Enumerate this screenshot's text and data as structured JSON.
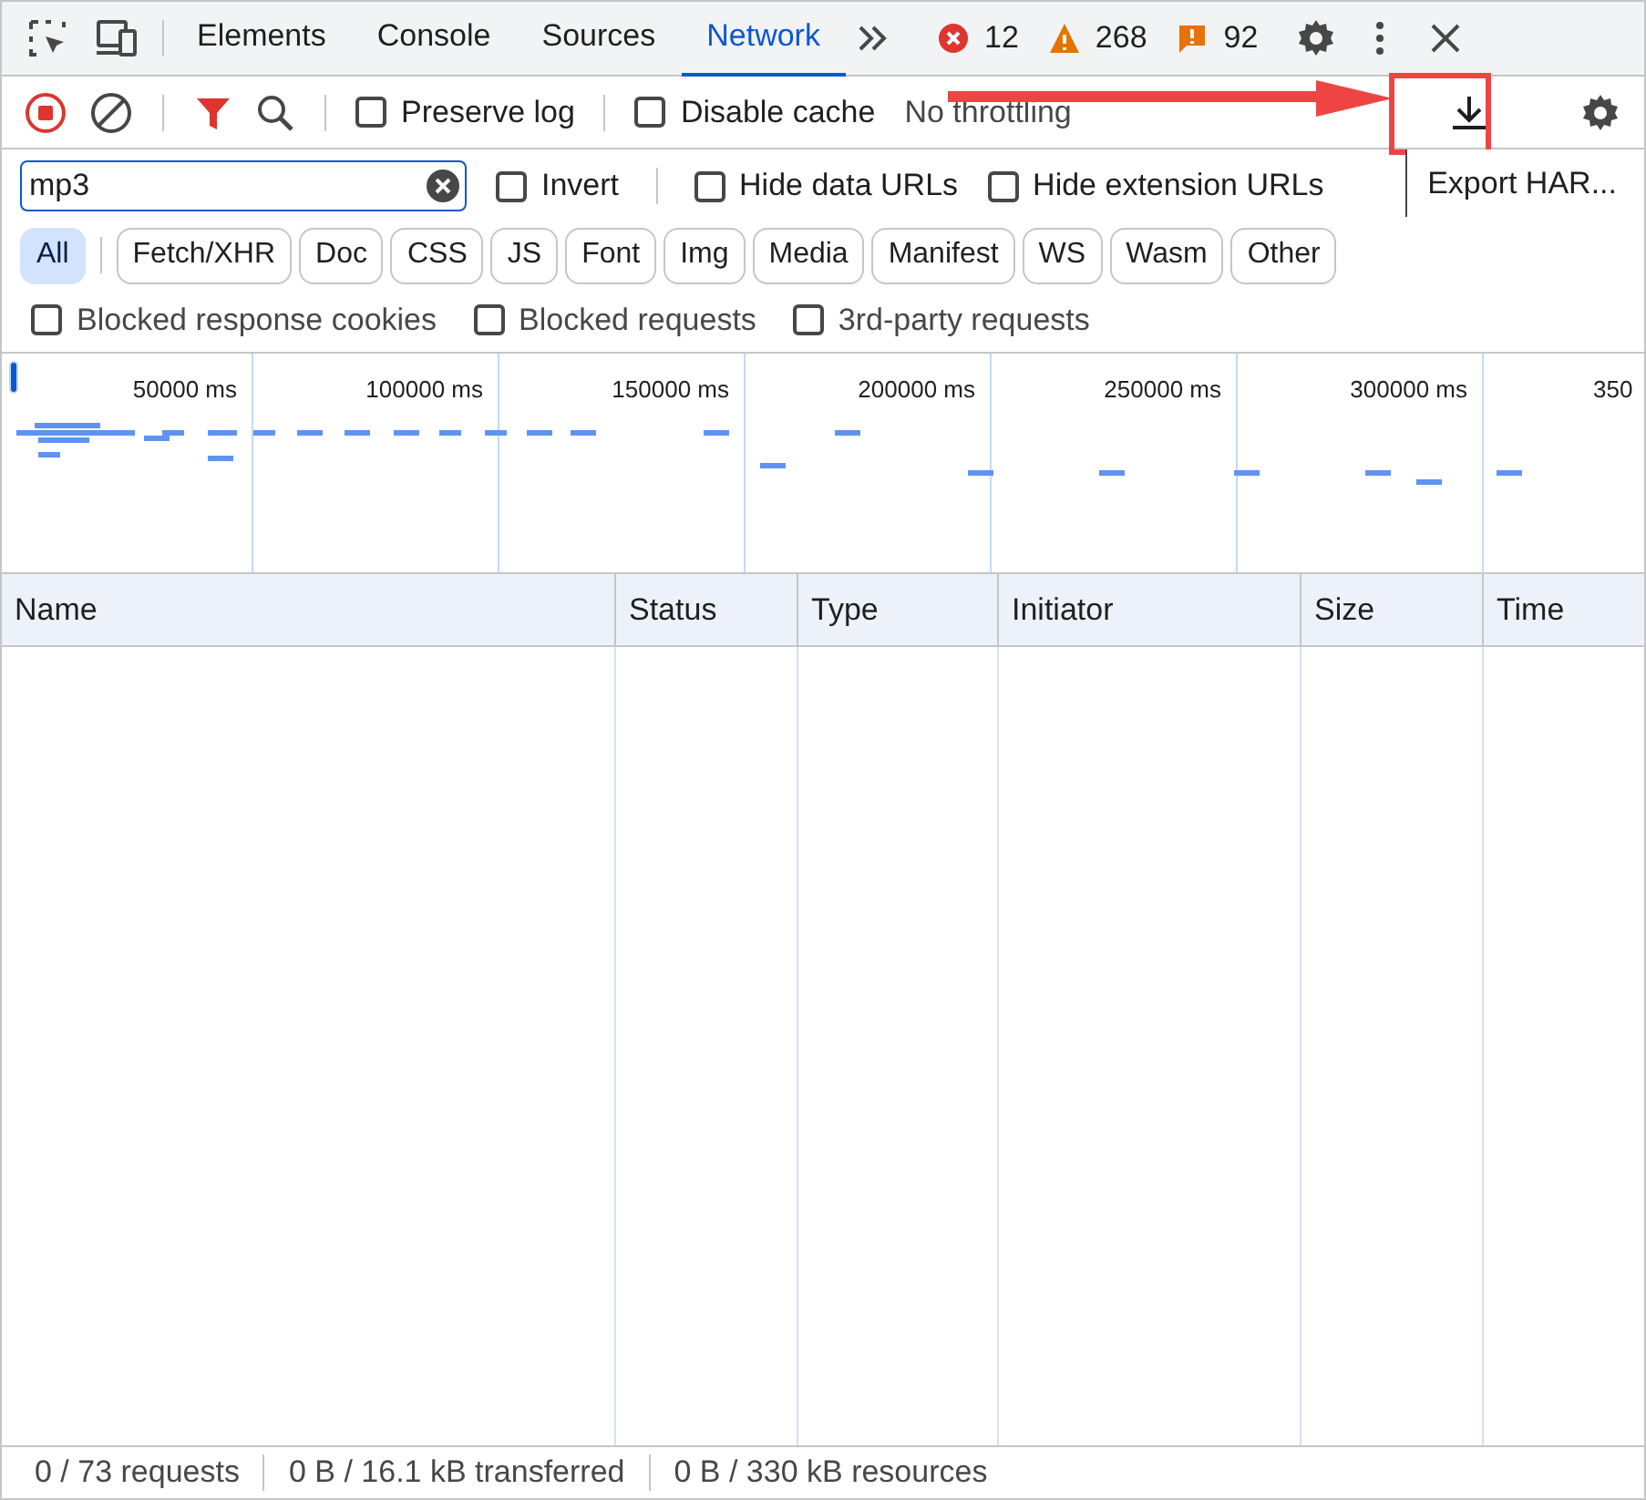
{
  "tabs": [
    {
      "label": "Elements",
      "selected": false
    },
    {
      "label": "Console",
      "selected": false
    },
    {
      "label": "Sources",
      "selected": false
    },
    {
      "label": "Network",
      "selected": true
    }
  ],
  "counters": {
    "errors": "12",
    "warnings": "268",
    "issues": "92"
  },
  "toolbar": {
    "recording": true,
    "preserve_log": {
      "label": "Preserve log",
      "checked": false
    },
    "disable_cache": {
      "label": "Disable cache",
      "checked": false
    },
    "throttling": "No throttling"
  },
  "tooltip": "Export HAR...",
  "filter": {
    "value": "mp3",
    "invert": {
      "label": "Invert",
      "checked": false
    },
    "hide_data_urls": {
      "label": "Hide data URLs",
      "checked": false
    },
    "hide_extension_urls": {
      "label": "Hide extension URLs",
      "checked": false
    }
  },
  "types": [
    {
      "label": "All",
      "selected": true
    },
    {
      "label": "Fetch/XHR",
      "selected": false
    },
    {
      "label": "Doc",
      "selected": false
    },
    {
      "label": "CSS",
      "selected": false
    },
    {
      "label": "JS",
      "selected": false
    },
    {
      "label": "Font",
      "selected": false
    },
    {
      "label": "Img",
      "selected": false
    },
    {
      "label": "Media",
      "selected": false
    },
    {
      "label": "Manifest",
      "selected": false
    },
    {
      "label": "WS",
      "selected": false
    },
    {
      "label": "Wasm",
      "selected": false
    },
    {
      "label": "Other",
      "selected": false
    }
  ],
  "options": [
    {
      "label": "Blocked response cookies",
      "checked": false
    },
    {
      "label": "Blocked requests",
      "checked": false
    },
    {
      "label": "3rd-party requests",
      "checked": false
    }
  ],
  "overview_ticks": [
    "50000 ms",
    "100000 ms",
    "150000 ms",
    "200000 ms",
    "250000 ms",
    "300000 ms",
    "350"
  ],
  "table": {
    "columns": [
      "Name",
      "Status",
      "Type",
      "Initiator",
      "Size",
      "Time"
    ]
  },
  "status_bar": [
    "0 / 73 requests",
    "0 B / 16.1 kB transferred",
    "0 B / 330 kB resources"
  ]
}
